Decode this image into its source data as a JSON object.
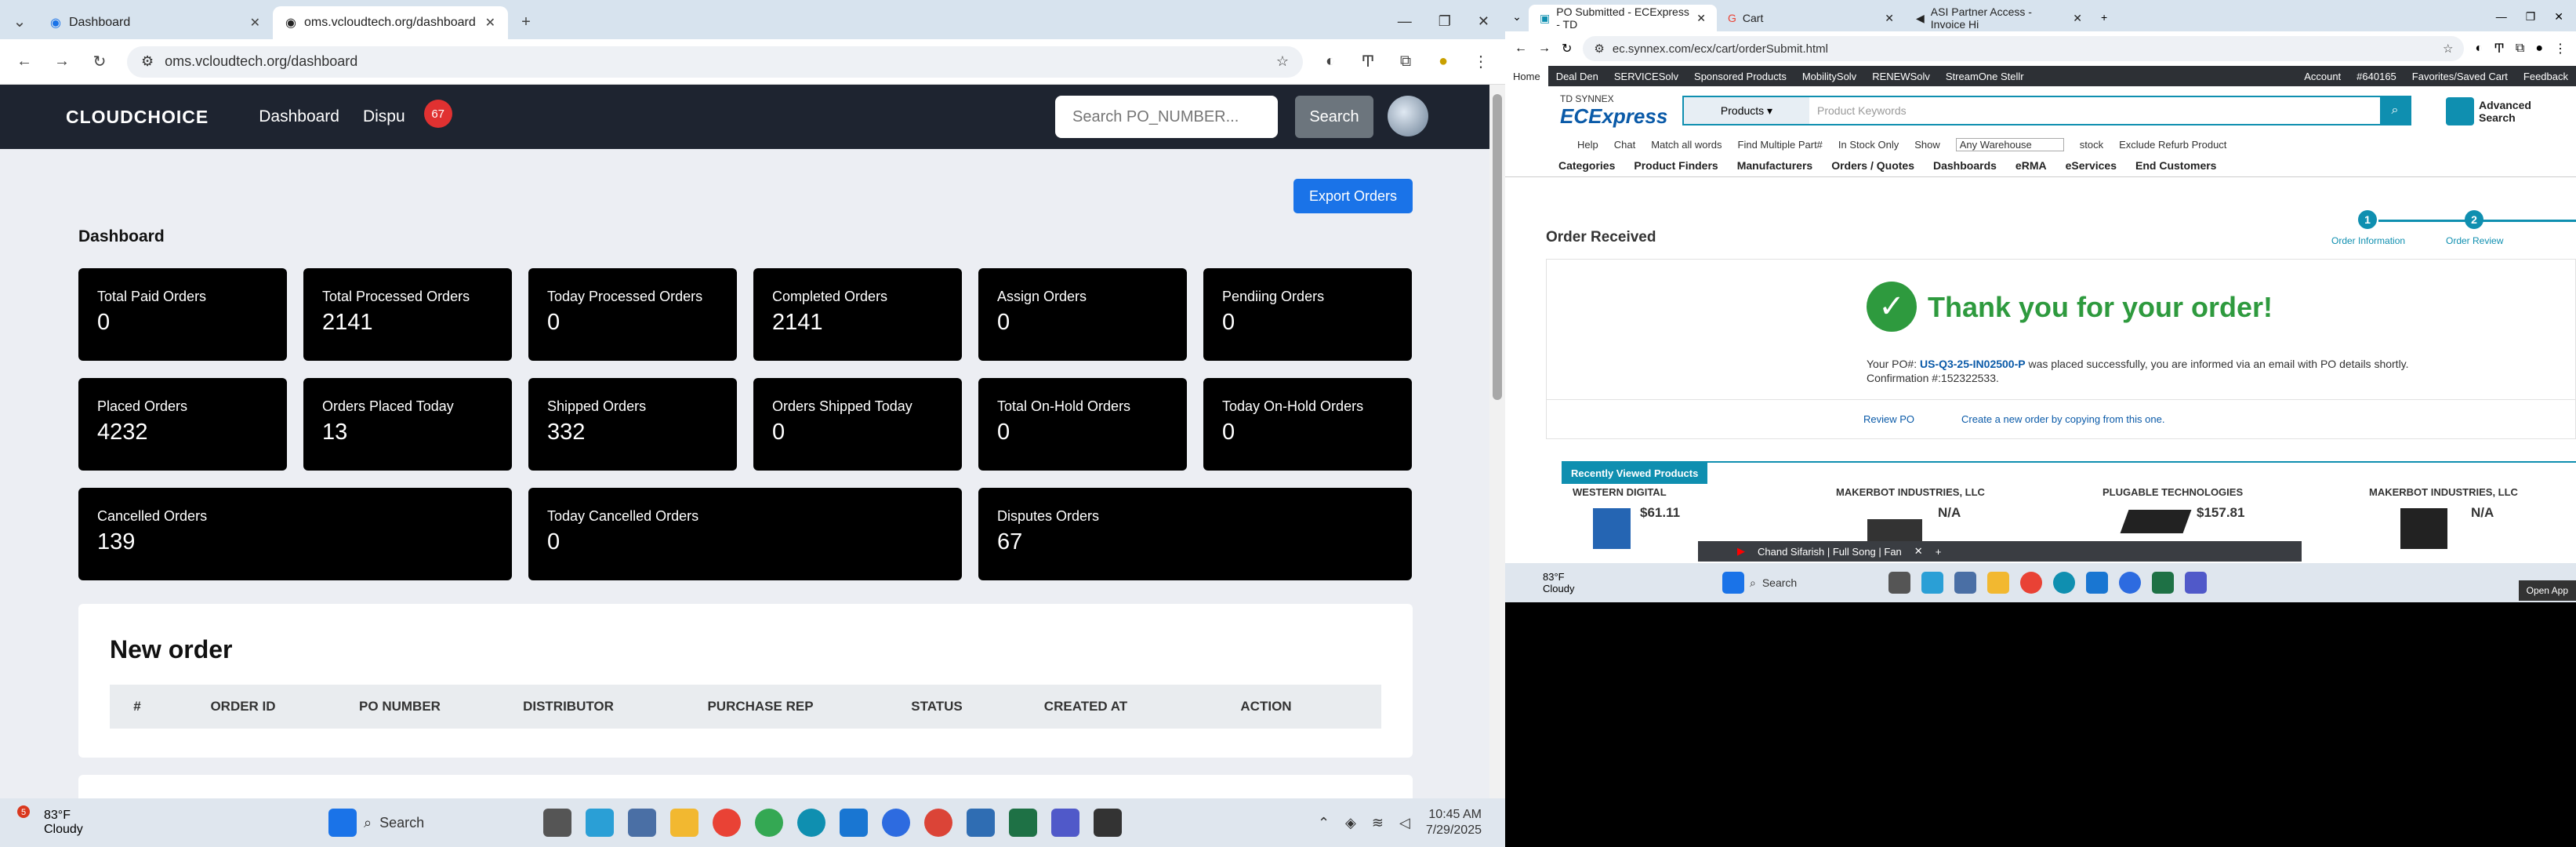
{
  "left": {
    "tabs": [
      {
        "label": "Dashboard"
      },
      {
        "label": "oms.vcloudtech.org/dashboard"
      }
    ],
    "url": "oms.vcloudtech.org/dashboard",
    "logo": "CLOUDCHOICE",
    "nav": {
      "dashboard": "Dashboard",
      "disputes": "Dispu",
      "disputes_badge": "67",
      "search_placeholder": "Search PO_NUMBER...",
      "search_button": "Search"
    },
    "export_button": "Export Orders",
    "dashboard_title": "Dashboard",
    "cards": [
      {
        "label": "Total Paid Orders",
        "value": "0"
      },
      {
        "label": "Total Processed Orders",
        "value": "2141"
      },
      {
        "label": "Today Processed Orders",
        "value": "0"
      },
      {
        "label": "Completed Orders",
        "value": "2141"
      },
      {
        "label": "Assign Orders",
        "value": "0"
      },
      {
        "label": "Pendiing Orders",
        "value": "0"
      },
      {
        "label": "Placed Orders",
        "value": "4232"
      },
      {
        "label": "Orders Placed Today",
        "value": "13"
      },
      {
        "label": "Shipped Orders",
        "value": "332"
      },
      {
        "label": "Orders Shipped Today",
        "value": "0"
      },
      {
        "label": "Total On-Hold Orders",
        "value": "0"
      },
      {
        "label": "Today On-Hold Orders",
        "value": "0"
      },
      {
        "label": "Cancelled Orders",
        "value": "139"
      },
      {
        "label": "Today Cancelled Orders",
        "value": "0"
      },
      {
        "label": "Disputes Orders",
        "value": "67"
      }
    ],
    "new_order": {
      "title": "New order",
      "columns": [
        "#",
        "ORDER ID",
        "PO NUMBER",
        "DISTRIBUTOR",
        "PURCHASE REP",
        "STATUS",
        "CREATED AT",
        "ACTION"
      ]
    },
    "taskbar": {
      "weather_temp": "83°F",
      "weather_desc": "Cloudy",
      "weather_badge": "5",
      "search": "Search",
      "time": "10:45 AM",
      "date": "7/29/2025"
    }
  },
  "right": {
    "tabs": [
      {
        "label": "PO Submitted - ECExpress - TD"
      },
      {
        "label": "Cart"
      },
      {
        "label": "ASI Partner Access - Invoice Hi"
      }
    ],
    "url": "ec.synnex.com/ecx/cart/orderSubmit.html",
    "topnav": [
      "Home",
      "Deal Den",
      "SERVICESolv",
      "Sponsored Products",
      "MobilitySolv",
      "RENEWSolv",
      "StreamOne Stellr"
    ],
    "topnav_right": [
      "Account",
      "#640165",
      "Favorites/Saved Cart",
      "Feedback"
    ],
    "brand_small": "TD SYNNEX",
    "brand": "ECExpress",
    "search_select": "Products",
    "search_placeholder": "Product Keywords",
    "advanced_search": "Advanced Search",
    "options": [
      "Help",
      "Chat",
      "Match all words",
      "Find Multiple Part#",
      "In Stock Only",
      "Show",
      "Any Warehouse",
      "stock",
      "Exclude Refurb Product"
    ],
    "categories": [
      "Categories",
      "Product Finders",
      "Manufacturers",
      "Orders / Quotes",
      "Dashboards",
      "eRMA",
      "eServices",
      "End Customers"
    ],
    "order_received": "Order Received",
    "steps": [
      {
        "num": "1",
        "label": "Order Information"
      },
      {
        "num": "2",
        "label": "Order Review"
      }
    ],
    "thank_you": "Thank you for your order!",
    "msg_prefix": "Your PO#:",
    "po_number": "US-Q3-25-IN02500-P",
    "msg_suffix": "was placed successfully, you are informed via an email with PO details shortly. Confirmation #:152322533.",
    "review_po": "Review PO",
    "create_new": "Create a new order by copying from this one.",
    "recently_viewed": "Recently Viewed Products",
    "products": [
      {
        "name": "WESTERN DIGITAL",
        "price": "$61.11"
      },
      {
        "name": "MAKERBOT INDUSTRIES, LLC",
        "price": "N/A"
      },
      {
        "name": "PLUGABLE TECHNOLOGIES",
        "price": "$157.81"
      },
      {
        "name": "MAKERBOT INDUSTRIES, LLC",
        "price": "N/A"
      }
    ],
    "popup_tab": "Chand Sifarish | Full Song | Fan",
    "taskbar": {
      "weather_temp": "83°F",
      "weather_desc": "Cloudy",
      "search": "Search",
      "open_app": "Open App"
    }
  }
}
